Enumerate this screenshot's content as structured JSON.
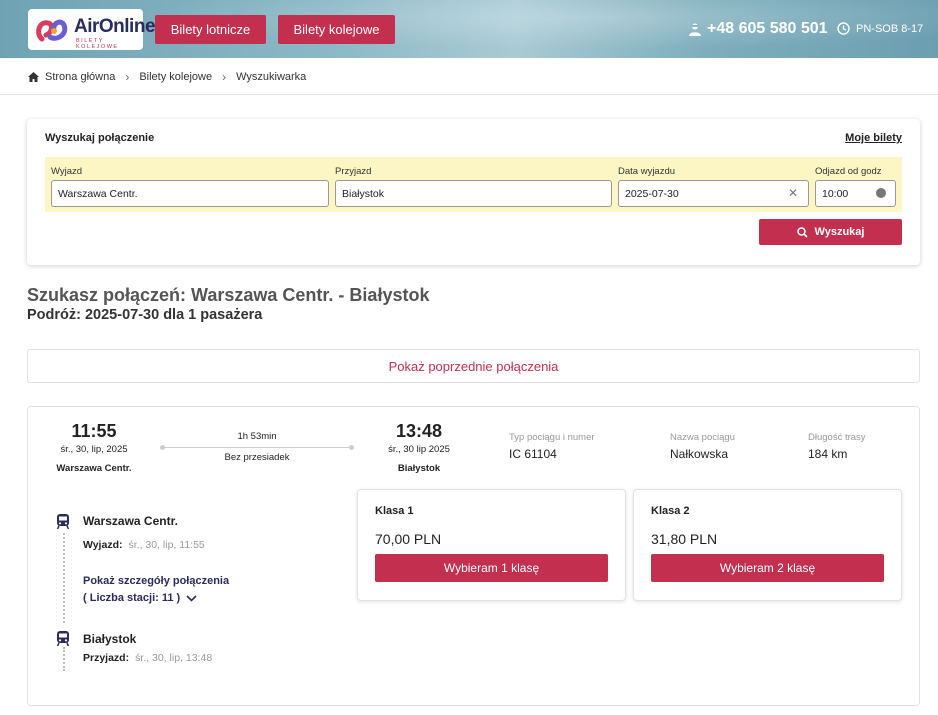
{
  "header": {
    "logo_name": "AirOnline",
    "logo_sub": "BILETY KOLEJOWE",
    "nav": [
      "Bilety lotnicze",
      "Bilety kolejowe"
    ],
    "phone": "+48 605 580 501",
    "hours": "PN-SOB 8-17"
  },
  "breadcrumb": [
    "Strona główna",
    "Bilety kolejowe",
    "Wyszukiwarka"
  ],
  "search": {
    "title": "Wyszukaj połączenie",
    "my_tickets": "Moje bilety",
    "from_label": "Wyjazd",
    "from_value": "Warszawa Centr.",
    "to_label": "Przyjazd",
    "to_value": "Białystok",
    "date_label": "Data wyjazdu",
    "date_value": "2025-07-30",
    "time_label": "Odjazd od godz",
    "time_value": "10:00",
    "button": "Wyszukaj"
  },
  "results": {
    "title": "Szukasz połączeń: Warszawa Centr. - Białystok",
    "subtitle": "Podróż: 2025-07-30 dla 1 pasażera",
    "prev": "Pokaż poprzednie połączenia"
  },
  "connection": {
    "dep_time": "11:55",
    "dep_date": "śr., 30, lip, 2025",
    "dep_station": "Warszawa Centr.",
    "duration": "1h 53min",
    "changes": "Bez przesiadek",
    "arr_time": "13:48",
    "arr_date": "śr., 30 lip 2025",
    "arr_station": "Białystok",
    "train_type_label": "Typ pociągu i numer",
    "train_type": "IC 61104",
    "train_name_label": "Nazwa pociągu",
    "train_name": "Nałkowska",
    "length_label": "Długość trasy",
    "length": "184 km",
    "timeline": {
      "from_station": "Warszawa Centr.",
      "dep_label": "Wyjazd:",
      "dep_value": "śr., 30, lip, 11:55",
      "details": "Pokaż szczegóły połączenia",
      "stations": "( Liczba stacji: 11 )",
      "to_station": "Białystok",
      "arr_label": "Przyjazd:",
      "arr_value": "śr., 30, lip, 13:48"
    },
    "classes": [
      {
        "name": "Klasa 1",
        "price": "70,00 PLN",
        "button": "Wybieram 1 klasę"
      },
      {
        "name": "Klasa 2",
        "price": "31,80 PLN",
        "button": "Wybieram 2 klasę"
      }
    ]
  },
  "colors": {
    "accent": "#c3304f",
    "navy": "#2a2b5e",
    "band": "#fbf6c3"
  }
}
